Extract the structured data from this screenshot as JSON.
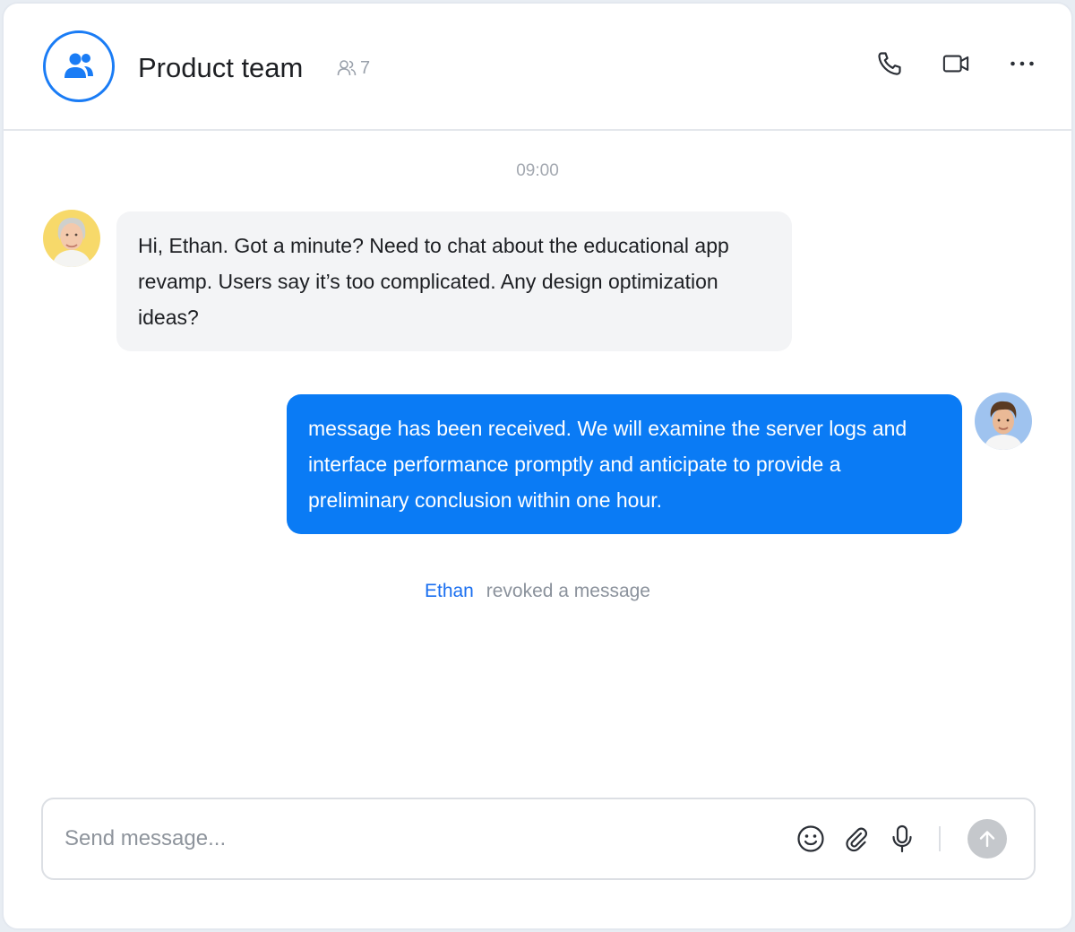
{
  "header": {
    "title": "Product team",
    "member_count": "7",
    "group_icon": "group-users-icon",
    "actions": [
      "phone-icon",
      "video-icon",
      "more-icon"
    ]
  },
  "conversation": {
    "timestamp": "09:00",
    "messages": [
      {
        "direction": "incoming",
        "text": "Hi, Ethan. Got a minute? Need to chat about the educational app revamp. Users say it’s too complicated. Any design optimization ideas?"
      },
      {
        "direction": "outgoing",
        "text": "message has been received. We will examine the server logs and interface performance promptly and anticipate to provide a preliminary conclusion within one hour."
      }
    ],
    "system_note": {
      "user": "Ethan",
      "action": "revoked a message"
    }
  },
  "composer": {
    "value": "",
    "placeholder": "Send message...",
    "tools": [
      "emoji-icon",
      "attachment-icon",
      "microphone-icon"
    ],
    "send_icon": "arrow-up-icon"
  },
  "colors": {
    "accent": "#0a7bf5",
    "incoming_bubble": "#f3f4f6",
    "send_disabled": "#c5c8cc"
  }
}
